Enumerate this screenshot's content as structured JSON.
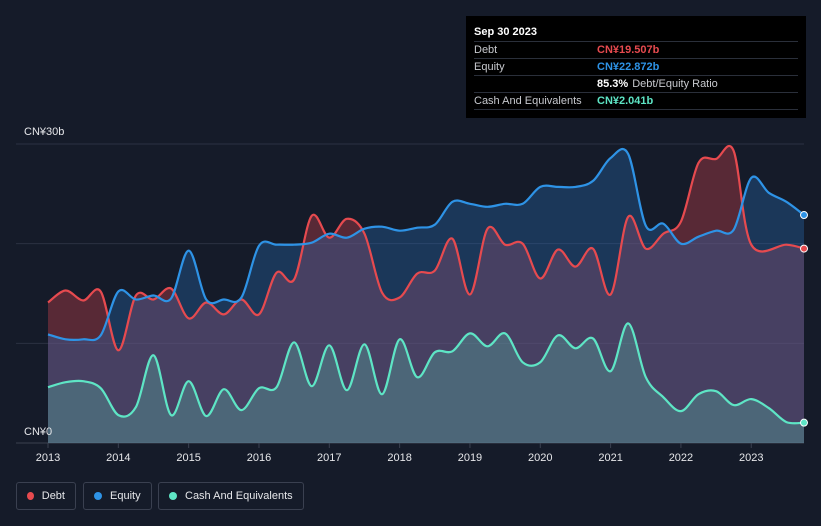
{
  "tooltip": {
    "date": "Sep 30 2023",
    "rows": [
      {
        "label": "Debt",
        "value": "CN¥19.507b",
        "color": "#e64a4f"
      },
      {
        "label": "Equity",
        "value": "CN¥22.872b",
        "color": "#2e93e6"
      },
      {
        "label": "",
        "value": "85.3%",
        "suffix": "Debt/Equity Ratio",
        "color": "#ffffff"
      },
      {
        "label": "Cash And Equivalents",
        "value": "CN¥2.041b",
        "color": "#5ee5c5"
      }
    ]
  },
  "legend": [
    {
      "label": "Debt",
      "color": "#e64a4f"
    },
    {
      "label": "Equity",
      "color": "#2e93e6"
    },
    {
      "label": "Cash And Equivalents",
      "color": "#5ee5c5"
    }
  ],
  "chart_data": {
    "type": "area",
    "y_top_label": "CN¥30b",
    "y_bottom_label": "CN¥0",
    "ylim": [
      0,
      30
    ],
    "xlim": [
      2013,
      2023.75
    ],
    "x_ticks": [
      "2013",
      "2014",
      "2015",
      "2016",
      "2017",
      "2018",
      "2019",
      "2020",
      "2021",
      "2022",
      "2023"
    ],
    "series": [
      {
        "name": "Debt",
        "color": "#e64a4f",
        "points": [
          [
            2013,
            14.1
          ],
          [
            2013.25,
            15.3
          ],
          [
            2013.5,
            14.3
          ],
          [
            2013.75,
            15.2
          ],
          [
            2014,
            9.3
          ],
          [
            2014.25,
            14.8
          ],
          [
            2014.5,
            14.4
          ],
          [
            2014.75,
            15.5
          ],
          [
            2015,
            12.5
          ],
          [
            2015.25,
            14.1
          ],
          [
            2015.5,
            12.9
          ],
          [
            2015.75,
            14.4
          ],
          [
            2016,
            12.9
          ],
          [
            2016.25,
            17.1
          ],
          [
            2016.5,
            16.4
          ],
          [
            2016.75,
            22.8
          ],
          [
            2017,
            20.6
          ],
          [
            2017.25,
            22.5
          ],
          [
            2017.5,
            21.0
          ],
          [
            2017.75,
            15.1
          ],
          [
            2018,
            14.6
          ],
          [
            2018.25,
            17.0
          ],
          [
            2018.5,
            17.3
          ],
          [
            2018.75,
            20.5
          ],
          [
            2019,
            14.9
          ],
          [
            2019.25,
            21.5
          ],
          [
            2019.5,
            19.9
          ],
          [
            2019.75,
            20.0
          ],
          [
            2020,
            16.5
          ],
          [
            2020.25,
            19.4
          ],
          [
            2020.5,
            17.7
          ],
          [
            2020.75,
            19.5
          ],
          [
            2021,
            14.9
          ],
          [
            2021.25,
            22.7
          ],
          [
            2021.5,
            19.5
          ],
          [
            2021.75,
            21.0
          ],
          [
            2022,
            22.2
          ],
          [
            2022.25,
            28.1
          ],
          [
            2022.5,
            28.5
          ],
          [
            2022.75,
            29.3
          ],
          [
            2023,
            19.9
          ],
          [
            2023.5,
            19.9
          ],
          [
            2023.75,
            19.507
          ]
        ]
      },
      {
        "name": "Equity",
        "color": "#2e93e6",
        "points": [
          [
            2013,
            10.9
          ],
          [
            2013.25,
            10.4
          ],
          [
            2013.5,
            10.4
          ],
          [
            2013.75,
            10.8
          ],
          [
            2014,
            15.2
          ],
          [
            2014.25,
            14.4
          ],
          [
            2014.5,
            14.8
          ],
          [
            2014.75,
            14.5
          ],
          [
            2015,
            19.3
          ],
          [
            2015.25,
            14.4
          ],
          [
            2015.5,
            14.4
          ],
          [
            2015.75,
            14.6
          ],
          [
            2016,
            19.8
          ],
          [
            2016.25,
            19.9
          ],
          [
            2016.5,
            19.9
          ],
          [
            2016.75,
            20.1
          ],
          [
            2017,
            21.0
          ],
          [
            2017.25,
            20.6
          ],
          [
            2017.5,
            21.5
          ],
          [
            2017.75,
            21.7
          ],
          [
            2018,
            21.3
          ],
          [
            2018.25,
            21.6
          ],
          [
            2018.5,
            21.9
          ],
          [
            2018.75,
            24.2
          ],
          [
            2019,
            24.0
          ],
          [
            2019.25,
            23.7
          ],
          [
            2019.5,
            24.0
          ],
          [
            2019.75,
            24.0
          ],
          [
            2020,
            25.7
          ],
          [
            2020.25,
            25.7
          ],
          [
            2020.5,
            25.7
          ],
          [
            2020.75,
            26.3
          ],
          [
            2021,
            28.6
          ],
          [
            2021.25,
            29.0
          ],
          [
            2021.5,
            21.8
          ],
          [
            2021.75,
            22.0
          ],
          [
            2022,
            20.0
          ],
          [
            2022.25,
            20.7
          ],
          [
            2022.5,
            21.3
          ],
          [
            2022.75,
            21.4
          ],
          [
            2023,
            26.6
          ],
          [
            2023.25,
            25.1
          ],
          [
            2023.5,
            24.2
          ],
          [
            2023.75,
            22.872
          ]
        ]
      },
      {
        "name": "Cash And Equivalents",
        "color": "#5ee5c5",
        "points": [
          [
            2013,
            5.6
          ],
          [
            2013.25,
            6.1
          ],
          [
            2013.5,
            6.2
          ],
          [
            2013.75,
            5.5
          ],
          [
            2014,
            2.8
          ],
          [
            2014.25,
            3.6
          ],
          [
            2014.5,
            8.8
          ],
          [
            2014.75,
            2.8
          ],
          [
            2015,
            6.2
          ],
          [
            2015.25,
            2.7
          ],
          [
            2015.5,
            5.4
          ],
          [
            2015.75,
            3.3
          ],
          [
            2016,
            5.5
          ],
          [
            2016.25,
            5.6
          ],
          [
            2016.5,
            10.1
          ],
          [
            2016.75,
            5.7
          ],
          [
            2017,
            9.8
          ],
          [
            2017.25,
            5.3
          ],
          [
            2017.5,
            9.9
          ],
          [
            2017.75,
            4.9
          ],
          [
            2018,
            10.4
          ],
          [
            2018.25,
            6.6
          ],
          [
            2018.5,
            9.1
          ],
          [
            2018.75,
            9.2
          ],
          [
            2019,
            11.0
          ],
          [
            2019.25,
            9.7
          ],
          [
            2019.5,
            11.0
          ],
          [
            2019.75,
            8.1
          ],
          [
            2020,
            8.1
          ],
          [
            2020.25,
            10.8
          ],
          [
            2020.5,
            9.5
          ],
          [
            2020.75,
            10.5
          ],
          [
            2021,
            7.2
          ],
          [
            2021.25,
            12.0
          ],
          [
            2021.5,
            6.6
          ],
          [
            2021.75,
            4.6
          ],
          [
            2022,
            3.2
          ],
          [
            2022.25,
            4.9
          ],
          [
            2022.5,
            5.2
          ],
          [
            2022.75,
            3.8
          ],
          [
            2023,
            4.4
          ],
          [
            2023.25,
            3.5
          ],
          [
            2023.5,
            2.1
          ],
          [
            2023.75,
            2.041
          ]
        ]
      }
    ]
  }
}
